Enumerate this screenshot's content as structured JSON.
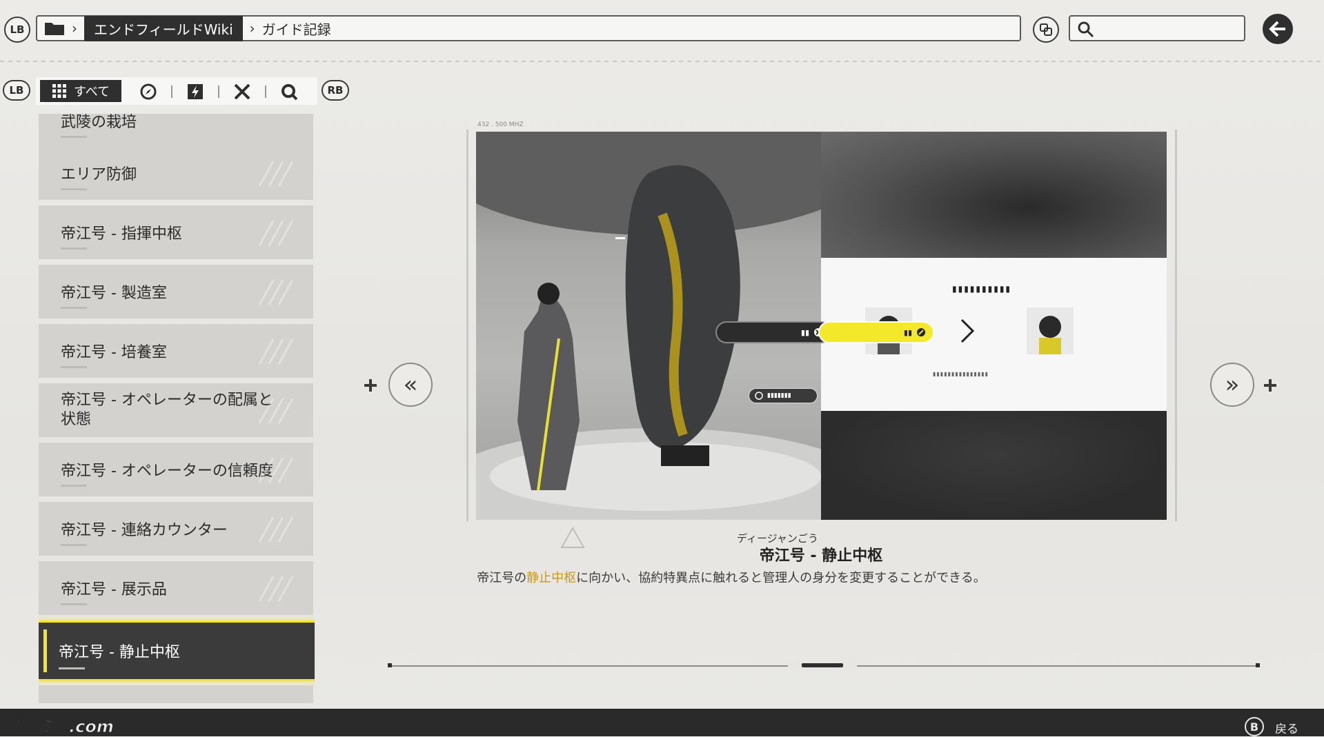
{
  "topbar": {
    "lb_label": "LB",
    "breadcrumb": {
      "wiki": "エンドフィールドWiki",
      "page": "ガイド記録"
    },
    "search_placeholder": ""
  },
  "filterbar": {
    "lb_label": "LB",
    "rb_label": "RB",
    "tabs": [
      {
        "label": "すべて",
        "icon": "grid-icon",
        "active": true
      },
      {
        "icon": "compass-icon"
      },
      {
        "icon": "lightning-icon"
      },
      {
        "icon": "crossed-tools-icon"
      },
      {
        "icon": "gear-magnify-icon"
      }
    ]
  },
  "sidebar": {
    "items": [
      {
        "label": "武陵の栽培"
      },
      {
        "label": "エリア防御"
      },
      {
        "label": "帝江号 - 指揮中枢"
      },
      {
        "label": "帝江号 - 製造室"
      },
      {
        "label": "帝江号 - 培養室"
      },
      {
        "label": "帝江号 - オペレーターの配属と\n状態"
      },
      {
        "label": "帝江号 - オペレーターの信頼度"
      },
      {
        "label": "帝江号 - 連絡カウンター"
      },
      {
        "label": "帝江号 - 展示品"
      },
      {
        "label": "帝江号 - 静止中枢",
        "active": true
      }
    ]
  },
  "preview": {
    "frequency": "432 . 500 MHZ",
    "nav_prev": "«",
    "nav_next": "»"
  },
  "caption": {
    "ruby": "ディージャンごう",
    "title": "帝江号 - 静止中枢",
    "desc_before": "帝江号の",
    "desc_highlight": "静止中枢",
    "desc_after": "に向かい、協約特異点に触れると管理人の身分を変更することができる。"
  },
  "progress": {
    "current_page": 2,
    "total_pages": 3
  },
  "bottombar": {
    "watermark": "ファミ通.com",
    "back_key": "B",
    "back_label": "戻る"
  },
  "colors": {
    "accent_yellow": "#f2e52a",
    "highlight_text": "#c99a12",
    "dark": "#2f2f2f"
  }
}
